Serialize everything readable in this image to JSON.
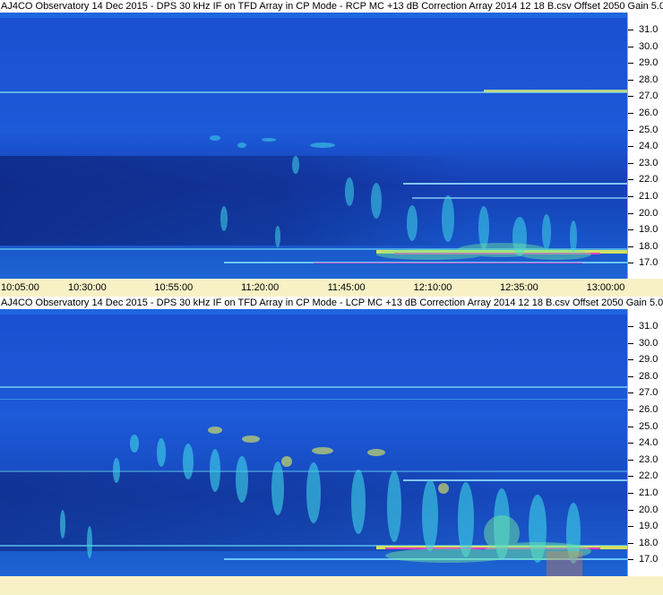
{
  "panels": [
    {
      "title": "AJ4CO Observatory 14 Dec 2015 - DPS 30 kHz IF on TFD Array in CP Mode - RCP  MC +13 dB  Correction Array 2014 12 18 B.csv  Offset 2050  Gain 5.0",
      "polarization": "RCP",
      "y_ticks": [
        "31.0",
        "30.0",
        "29.0",
        "28.0",
        "27.0",
        "26.0",
        "25.0",
        "24.0",
        "23.0",
        "22.0",
        "21.0",
        "20.0",
        "19.0",
        "18.0",
        "17.0"
      ],
      "x_ticks": [
        "10:05:00",
        "10:30:00",
        "10:55:00",
        "11:20:00",
        "11:45:00",
        "12:10:00",
        "12:35:00",
        "13:00:00"
      ]
    },
    {
      "title": "AJ4CO Observatory 14 Dec 2015 - DPS 30 kHz IF on TFD Array in CP Mode - LCP  MC +13 dB  Correction Array 2014 12 18 B.csv  Offset 2050  Gain 5.0",
      "polarization": "LCP",
      "y_ticks": [
        "31.0",
        "30.0",
        "29.0",
        "28.0",
        "27.0",
        "26.0",
        "25.0",
        "24.0",
        "23.0",
        "22.0",
        "21.0",
        "20.0",
        "19.0",
        "18.0",
        "17.0"
      ],
      "x_ticks": []
    }
  ],
  "colors": {
    "background_blue": "#1b49c8",
    "deep_blue": "#0e2f8e",
    "burst_cyan": "#3fd6e8",
    "burst_green": "#6ee6a0",
    "burst_yellow": "#e6f05a",
    "interference_magenta": "#e040c0",
    "axis_background": "#f8f1c6"
  }
}
